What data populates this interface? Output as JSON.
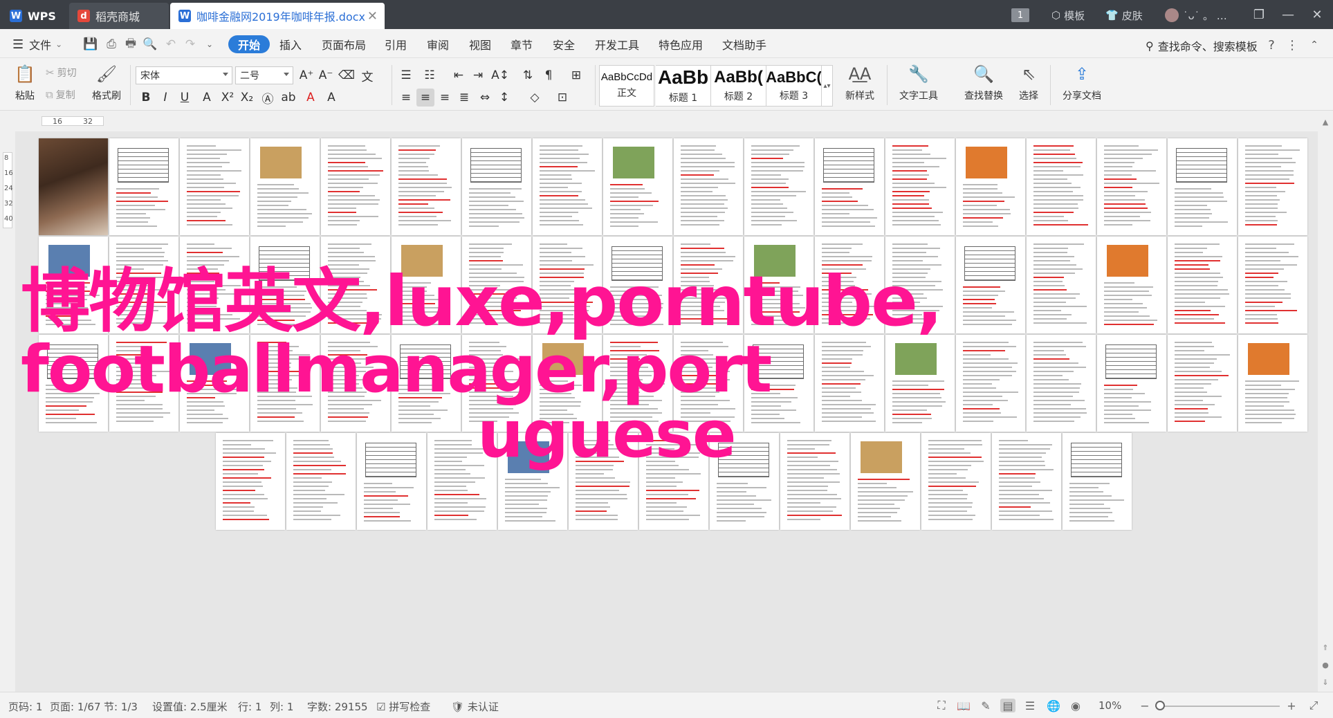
{
  "titlebar": {
    "wps_label": "WPS",
    "docer_tab": "稻壳商城",
    "doc_tab": "咖啡金融网2019年咖啡年报.docx",
    "add_tab": "+",
    "num_badge": "1",
    "template_btn": "模板",
    "skin_btn": "皮肤",
    "user_text": "˙ᴗ˙ 。 …"
  },
  "menubar": {
    "file": "文件",
    "items": [
      "开始",
      "插入",
      "页面布局",
      "引用",
      "审阅",
      "视图",
      "章节",
      "安全",
      "开发工具",
      "特色应用",
      "文档助手"
    ],
    "active": "开始",
    "search": "查找命令、搜索模板"
  },
  "ribbon": {
    "paste": "粘贴",
    "cut": "剪切",
    "copy": "复制",
    "format_painter": "格式刷",
    "font_name": "宋体",
    "font_size": "二号",
    "styles": [
      {
        "sample": "AaBbCcDd",
        "name": "正文"
      },
      {
        "sample": "AaBb",
        "name": "标题 1"
      },
      {
        "sample": "AaBb(",
        "name": "标题 2"
      },
      {
        "sample": "AaBbC(",
        "name": "标题 3"
      }
    ],
    "new_style": "新样式",
    "text_tools": "文字工具",
    "find_replace": "查找替换",
    "select": "选择",
    "share_doc": "分享文档"
  },
  "ruler": {
    "h1": "16",
    "h2": "32",
    "v": [
      "8",
      "16",
      "24",
      "32",
      "40"
    ]
  },
  "overlay": {
    "line1": "博物馆英文,luxe,porntube,",
    "line2": "footballmanager,port",
    "line3": "uguese"
  },
  "statusbar": {
    "page_no": "页码: 1",
    "page": "页面: 1/67",
    "section": "节: 1/3",
    "setting": "设置值: 2.5厘米",
    "row": "行: 1",
    "col": "列: 1",
    "words": "字数: 29155",
    "spell": "拼写检查",
    "cert": "未认证",
    "zoom": "10%"
  }
}
